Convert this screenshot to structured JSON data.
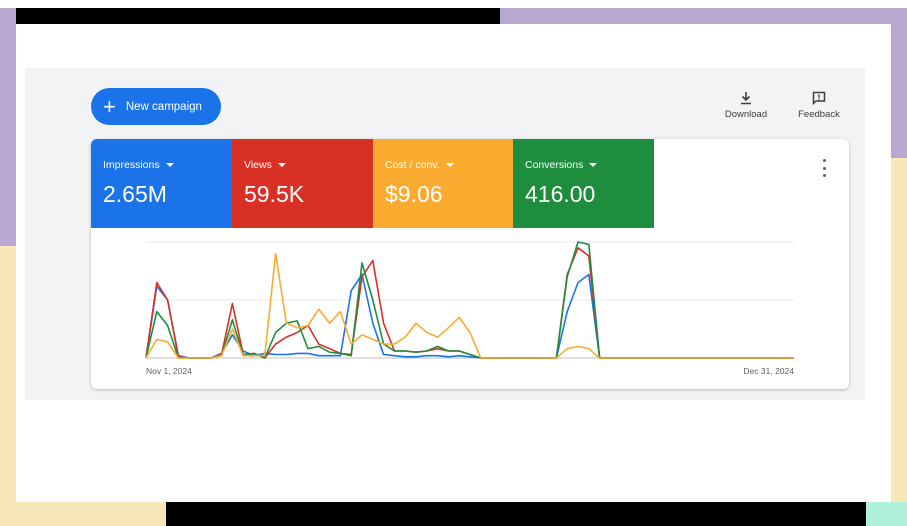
{
  "toolbar": {
    "new_campaign_label": "New campaign",
    "download_label": "Download",
    "feedback_label": "Feedback"
  },
  "metrics": [
    {
      "label": "Impressions",
      "value": "2.65M",
      "color": "#1a73e8"
    },
    {
      "label": "Views",
      "value": "59.5K",
      "color": "#d93025"
    },
    {
      "label": "Cost / conv.",
      "value": "$9.06",
      "color": "#f9ab2f"
    },
    {
      "label": "Conversions",
      "value": "416.00",
      "color": "#1e8e3e"
    }
  ],
  "chart_data": {
    "type": "line",
    "x_start_label": "Nov 1, 2024",
    "x_end_label": "Dec 31, 2024",
    "ylim": [
      0,
      100
    ],
    "grid": true,
    "series": [
      {
        "color": "#1a73e8",
        "values": [
          0,
          62,
          50,
          2,
          0,
          0,
          0,
          4,
          20,
          6,
          2,
          4,
          3,
          3,
          4,
          4,
          2,
          2,
          2,
          58,
          72,
          30,
          3,
          2,
          1,
          1,
          2,
          2,
          1,
          2,
          1,
          0,
          0,
          0,
          0,
          0,
          0,
          0,
          0,
          40,
          65,
          72,
          0,
          0,
          0,
          0,
          0,
          0,
          0,
          0,
          0,
          0,
          0,
          0,
          0,
          0,
          0,
          0,
          0,
          0,
          0
        ]
      },
      {
        "color": "#d93025",
        "values": [
          0,
          65,
          50,
          1,
          0,
          0,
          0,
          3,
          47,
          3,
          4,
          0,
          12,
          18,
          22,
          28,
          12,
          8,
          4,
          3,
          70,
          84,
          30,
          6,
          6,
          5,
          6,
          8,
          6,
          6,
          3,
          0,
          0,
          0,
          0,
          0,
          0,
          0,
          0,
          72,
          95,
          88,
          0,
          0,
          0,
          0,
          0,
          0,
          0,
          0,
          0,
          0,
          0,
          0,
          0,
          0,
          0,
          0,
          0,
          0,
          0
        ]
      },
      {
        "color": "#1e8e3e",
        "values": [
          0,
          40,
          28,
          0,
          0,
          0,
          0,
          2,
          33,
          2,
          4,
          0,
          22,
          30,
          32,
          8,
          10,
          5,
          4,
          2,
          82,
          50,
          12,
          6,
          6,
          5,
          6,
          10,
          6,
          6,
          3,
          0,
          0,
          0,
          0,
          0,
          0,
          0,
          0,
          70,
          100,
          98,
          0,
          0,
          0,
          0,
          0,
          0,
          0,
          0,
          0,
          0,
          0,
          0,
          0,
          0,
          0,
          0,
          0,
          0,
          0
        ]
      },
      {
        "color": "#f9ab2f",
        "values": [
          0,
          16,
          14,
          0,
          0,
          0,
          0,
          2,
          25,
          2,
          2,
          2,
          90,
          30,
          26,
          28,
          42,
          30,
          40,
          12,
          20,
          16,
          12,
          12,
          18,
          30,
          22,
          18,
          26,
          35,
          22,
          0,
          0,
          0,
          0,
          0,
          0,
          0,
          0,
          8,
          10,
          8,
          0,
          0,
          0,
          0,
          0,
          0,
          0,
          0,
          0,
          0,
          0,
          0,
          0,
          0,
          0,
          0,
          0,
          0,
          0
        ]
      }
    ]
  }
}
